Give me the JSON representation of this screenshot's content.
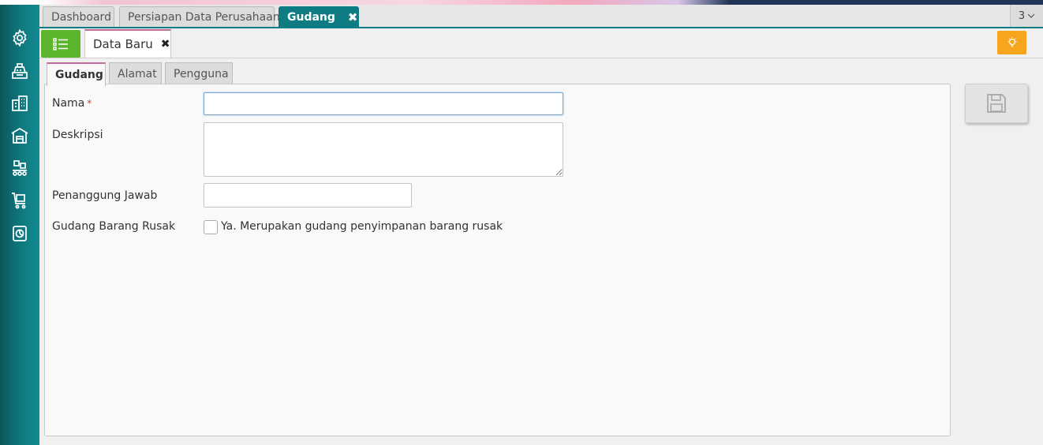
{
  "colors": {
    "sidebar": "#0e7c82",
    "active_tab": "#0e7c82",
    "menu_button": "#5cb52c",
    "hint_button": "#f7a51c",
    "required_mark": "#d9363e"
  },
  "sidebar": {
    "icons": [
      "gear-icon",
      "cash-register-icon",
      "building-icon",
      "warehouse-icon",
      "conveyor-icon",
      "cart-icon",
      "report-icon"
    ]
  },
  "top_tabs": [
    {
      "label": "Dashboard",
      "active": false
    },
    {
      "label": "Persiapan Data Perusahaan",
      "active": false
    },
    {
      "label": "Gudang",
      "active": true,
      "close": "✖"
    }
  ],
  "tab_count": "3",
  "subtab": {
    "label": "Data Baru",
    "close": "✖"
  },
  "form_tabs": [
    {
      "label": "Gudang",
      "active": true
    },
    {
      "label": "Alamat",
      "active": false
    },
    {
      "label": "Pengguna",
      "active": false
    }
  ],
  "form": {
    "nama": {
      "label": "Nama",
      "required": "*",
      "value": ""
    },
    "deskripsi": {
      "label": "Deskripsi",
      "value": ""
    },
    "penanggung": {
      "label": "Penanggung Jawab",
      "value": ""
    },
    "rusak": {
      "label": "Gudang Barang Rusak",
      "checkbox_label": "Ya. Merupakan gudang penyimpanan barang rusak",
      "checked": false
    }
  }
}
